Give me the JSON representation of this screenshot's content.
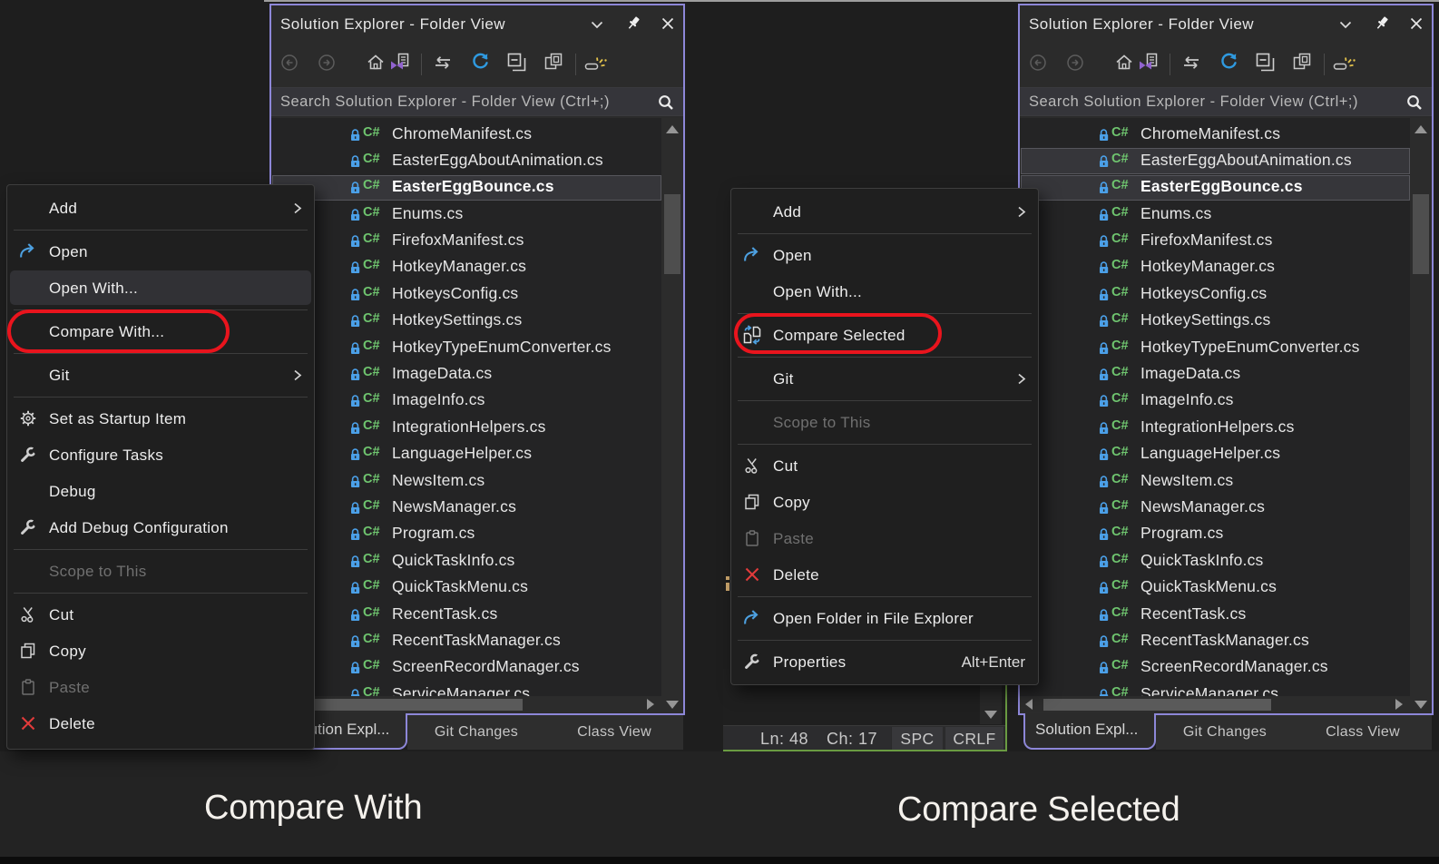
{
  "colors": {
    "page_background": "#1e1e1e",
    "lower_band": "#232323",
    "bottom_strip": "#0c0c0c",
    "top_edge_strip": "#9e9e9e",
    "panel_border_purple": "#8d87d8",
    "panel_background": "#2b2b2b",
    "tree_background": "#242425",
    "selection_background": "#36363a",
    "selection_border": "#56565c",
    "menu_background": "#1f1f1f",
    "red_annotation": "#e9141d",
    "editor_green_border": "#6a9b42",
    "blue_icon": "#4da0e0",
    "csharp_icon_green": "#6fc56f",
    "lock_icon_blue": "#4ba0e8"
  },
  "shared": {
    "window_title": "Solution Explorer - Folder View",
    "titlebar_icons": [
      "chevron-down-icon",
      "pin-icon",
      "close-icon"
    ],
    "toolbar_icons": [
      "back-icon",
      "forward-icon",
      "home-icon",
      "switch-views-icon",
      "separator",
      "sync-with-active-document-icon",
      "refresh-icon",
      "collapse-all-icon",
      "preview-selected-items-icon",
      "separator",
      "track-active-item-icon"
    ],
    "search_placeholder": "Search Solution Explorer - Folder View (Ctrl+;)",
    "files": [
      "ChromeManifest.cs",
      "EasterEggAboutAnimation.cs",
      "EasterEggBounce.cs",
      "Enums.cs",
      "FirefoxManifest.cs",
      "HotkeyManager.cs",
      "HotkeysConfig.cs",
      "HotkeySettings.cs",
      "HotkeyTypeEnumConverter.cs",
      "ImageData.cs",
      "ImageInfo.cs",
      "IntegrationHelpers.cs",
      "LanguageHelper.cs",
      "NewsItem.cs",
      "NewsManager.cs",
      "Program.cs",
      "QuickTaskInfo.cs",
      "QuickTaskMenu.cs",
      "RecentTask.cs",
      "RecentTaskManager.cs",
      "ScreenRecordManager.cs",
      "ServiceManager.cs"
    ],
    "file_icon": "csharp-file-icon",
    "file_lock_icon": "lock-icon",
    "tabs": [
      "Solution Expl...",
      "Git Changes",
      "Class View"
    ],
    "active_tab": "Solution Expl..."
  },
  "left_panel": {
    "selected_files": [
      "EasterEggBounce.cs"
    ],
    "focused_file": "EasterEggBounce.cs"
  },
  "right_panel": {
    "selected_files": [
      "EasterEggAboutAnimation.cs",
      "EasterEggBounce.cs"
    ],
    "focused_file": "EasterEggBounce.cs"
  },
  "left_menu": {
    "items": [
      {
        "label": "Add",
        "submenu": true
      },
      {
        "separator": true
      },
      {
        "label": "Open",
        "icon": "open-arrow-icon"
      },
      {
        "label": "Open With...",
        "hover": true
      },
      {
        "separator": true
      },
      {
        "label": "Compare With...",
        "annotated": true
      },
      {
        "separator": true
      },
      {
        "label": "Git",
        "submenu": true
      },
      {
        "separator": true
      },
      {
        "label": "Set as Startup Item",
        "icon": "gear-icon"
      },
      {
        "label": "Configure Tasks",
        "icon": "wrench-icon"
      },
      {
        "label": "Debug"
      },
      {
        "label": "Add Debug Configuration",
        "icon": "wrench-icon"
      },
      {
        "separator": true
      },
      {
        "label": "Scope to This",
        "disabled": true
      },
      {
        "separator": true
      },
      {
        "label": "Cut",
        "icon": "scissors-icon"
      },
      {
        "label": "Copy",
        "icon": "copy-icon"
      },
      {
        "label": "Paste",
        "icon": "paste-icon",
        "disabled": true
      },
      {
        "label": "Delete",
        "icon": "delete-x-icon"
      }
    ]
  },
  "right_menu": {
    "items": [
      {
        "label": "Add",
        "submenu": true
      },
      {
        "separator": true
      },
      {
        "label": "Open",
        "icon": "open-arrow-icon"
      },
      {
        "label": "Open With..."
      },
      {
        "separator": true
      },
      {
        "label": "Compare Selected",
        "icon": "compare-files-icon",
        "annotated": true
      },
      {
        "separator": true
      },
      {
        "label": "Git",
        "submenu": true
      },
      {
        "separator": true
      },
      {
        "label": "Scope to This",
        "disabled": true
      },
      {
        "separator": true
      },
      {
        "label": "Cut",
        "icon": "scissors-icon"
      },
      {
        "label": "Copy",
        "icon": "copy-icon"
      },
      {
        "label": "Paste",
        "icon": "paste-icon",
        "disabled": true
      },
      {
        "label": "Delete",
        "icon": "delete-x-icon"
      },
      {
        "separator": true
      },
      {
        "label": "Open Folder in File Explorer",
        "icon": "open-arrow-icon"
      },
      {
        "separator": true
      },
      {
        "label": "Properties",
        "icon": "wrench-icon",
        "shortcut": "Alt+Enter"
      }
    ]
  },
  "editor_statusbar": {
    "line": "Ln: 48",
    "column": "Ch: 17",
    "spaces": "SPC",
    "line_ending": "CRLF"
  },
  "captions": {
    "left": "Compare With",
    "right": "Compare Selected"
  }
}
